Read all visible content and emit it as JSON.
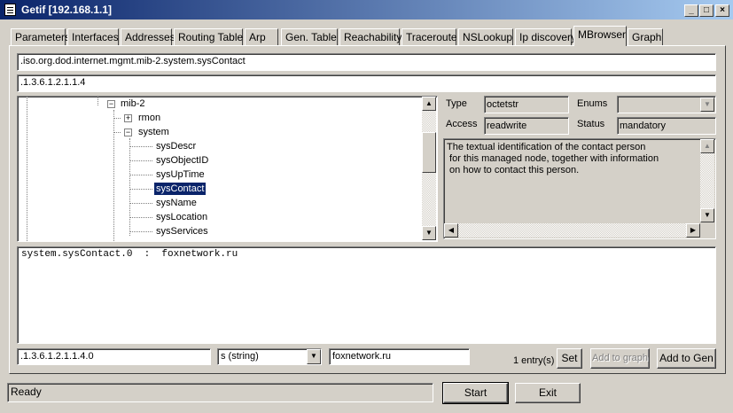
{
  "window": {
    "title": "Getif [192.168.1.1]",
    "min": "_",
    "max": "□",
    "close": "×"
  },
  "tabs": [
    {
      "label": "Parameters"
    },
    {
      "label": "Interfaces"
    },
    {
      "label": "Addresses"
    },
    {
      "label": "Routing Table"
    },
    {
      "label": "Arp"
    },
    {
      "label": "Gen. Table"
    },
    {
      "label": "Reachability"
    },
    {
      "label": "Traceroute"
    },
    {
      "label": "NSLookup"
    },
    {
      "label": "Ip discovery"
    },
    {
      "label": "MBrowser"
    },
    {
      "label": "Graph"
    }
  ],
  "active_tab": "MBrowser",
  "oid_name": ".iso.org.dod.internet.mgmt.mib-2.system.sysContact",
  "oid_numeric": ".1.3.6.1.2.1.1.4",
  "tree": {
    "mib2": "mib-2",
    "rmon": "rmon",
    "system": "system",
    "items": [
      "sysDescr",
      "sysObjectID",
      "sysUpTime",
      "sysContact",
      "sysName",
      "sysLocation",
      "sysServices"
    ],
    "selected": "sysContact",
    "expand_plus": "+",
    "collapse_minus": "−"
  },
  "info": {
    "type_label": "Type",
    "type_value": "octetstr",
    "enums_label": "Enums",
    "enums_value": "",
    "access_label": "Access",
    "access_value": "readwrite",
    "status_label": "Status",
    "status_value": "mandatory",
    "description": "The textual identification of the contact person\n for this managed node, together with information\n on how to contact this person."
  },
  "results": "system.sysContact.0  :  foxnetwork.ru",
  "bottom": {
    "oid_input": ".1.3.6.1.2.1.1.4.0",
    "type_select": "s (string)",
    "value_input": "foxnetwork.ru",
    "entry_count": "1 entry(s)",
    "set_label": "Set",
    "add_graph_label": "Add to graph",
    "add_gen_label": "Add to Gen"
  },
  "statusbar": {
    "text": "Ready",
    "start_label": "Start",
    "exit_label": "Exit"
  },
  "arrows": {
    "up": "▲",
    "down": "▼",
    "left": "◀",
    "right": "▶"
  }
}
